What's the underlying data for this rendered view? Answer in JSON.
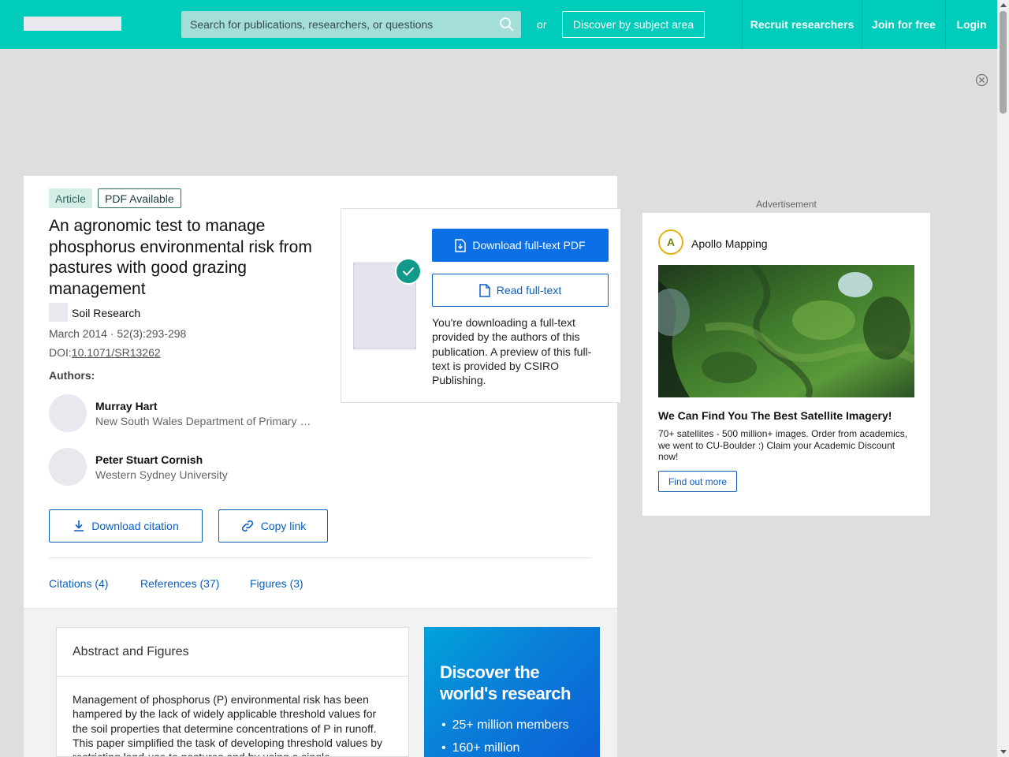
{
  "header": {
    "search_placeholder": "Search for publications, researchers, or questions",
    "or_text": "or",
    "discover_label": "Discover by subject area",
    "nav": [
      "Recruit researchers",
      "Join for free",
      "Login"
    ],
    "brand_color": "#00ccbb"
  },
  "article": {
    "type_badge": "Article",
    "pdf_badge": "PDF Available",
    "title": "An agronomic test to manage phosphorus environmental risk from pastures with good grazing management",
    "journal": "Soil Research",
    "date_volume": "March 2014 · 52(3):293-298",
    "doi_prefix": "DOI:",
    "doi": "10.1071/SR13262",
    "authors_label": "Authors:",
    "authors": [
      {
        "name": "Murray Hart",
        "affiliation": "New South Wales Department of Primary …"
      },
      {
        "name": "Peter Stuart Cornish",
        "affiliation": "Western Sydney University"
      }
    ],
    "download_citation": "Download citation",
    "copy_link": "Copy link",
    "tabs": [
      "Citations (4)",
      "References (37)",
      "Figures (3)"
    ]
  },
  "download_panel": {
    "download_label": "Download full-text PDF",
    "read_label": "Read full-text",
    "note": "You're downloading a full-text provided by the authors of this publication. A preview of this full-text is provided by CSIRO Publishing."
  },
  "ad": {
    "label": "Advertisement",
    "brand": "Apollo Mapping",
    "logo_text": "A",
    "headline": "We Can Find You The Best Satellite Imagery!",
    "body": "70+ satellites - 500 million+ images. Order from academics, we went to CU-Boulder :) Claim your Academic Discount now!",
    "cta": "Find out more"
  },
  "abstract": {
    "heading": "Abstract and Figures",
    "text": "Management of phosphorus (P) environmental risk has been hampered by the lack of widely applicable threshold values for the soil properties that determine concentrations of P in runoff. This paper simplified the task of developing threshold values by restricting land-use to pastures and by using a single"
  },
  "promo": {
    "title": "Discover the world's research",
    "items": [
      "25+ million members",
      "160+ million"
    ]
  }
}
